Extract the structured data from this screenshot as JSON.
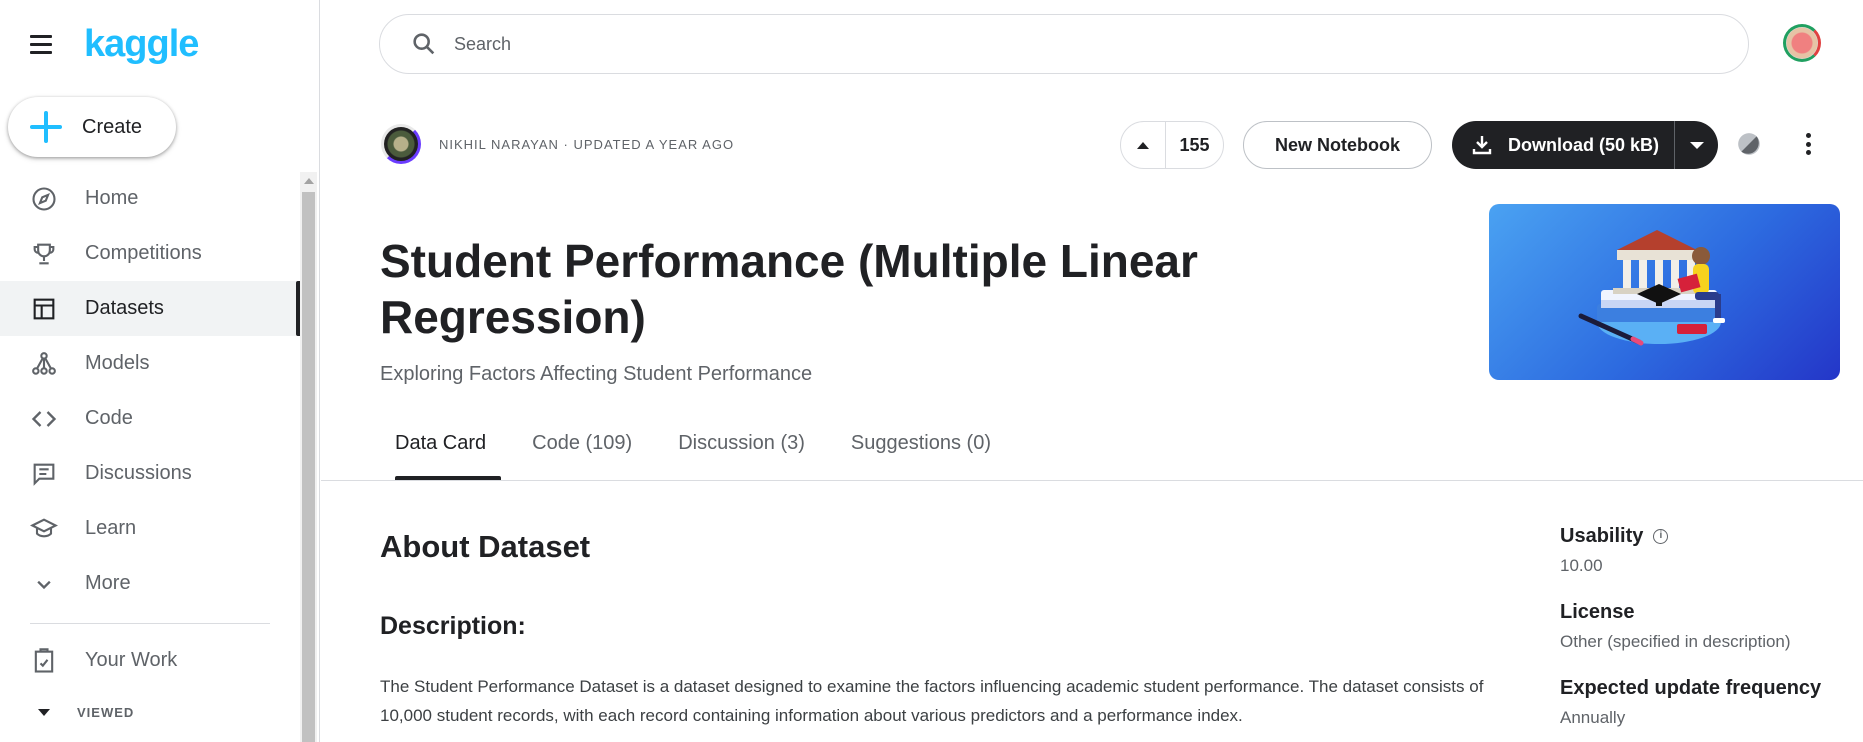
{
  "sidebar": {
    "logo": "kaggle",
    "create_label": "Create",
    "items": [
      {
        "label": "Home",
        "icon": "compass-icon",
        "active": false
      },
      {
        "label": "Competitions",
        "icon": "trophy-icon",
        "active": false
      },
      {
        "label": "Datasets",
        "icon": "table-icon",
        "active": true
      },
      {
        "label": "Models",
        "icon": "models-icon",
        "active": false
      },
      {
        "label": "Code",
        "icon": "code-icon",
        "active": false
      },
      {
        "label": "Discussions",
        "icon": "chat-icon",
        "active": false
      },
      {
        "label": "Learn",
        "icon": "graduation-cap-icon",
        "active": false
      },
      {
        "label": "More",
        "icon": "chevron-down-icon",
        "active": false
      }
    ],
    "your_work_label": "Your Work",
    "viewed_label": "VIEWED"
  },
  "search": {
    "placeholder": "Search"
  },
  "dataset": {
    "owner_meta": "NIKHIL NARAYAN · UPDATED A YEAR AGO",
    "votes": "155",
    "new_notebook_label": "New Notebook",
    "download_label": "Download (50 kB)",
    "title": "Student Performance (Multiple Linear Regression)",
    "subtitle": "Exploring Factors Affecting Student Performance"
  },
  "tabs": [
    {
      "label": "Data Card",
      "active": true
    },
    {
      "label": "Code (109)",
      "active": false
    },
    {
      "label": "Discussion (3)",
      "active": false
    },
    {
      "label": "Suggestions (0)",
      "active": false
    }
  ],
  "content": {
    "about_heading": "About Dataset",
    "description_heading": "Description:",
    "description_text": "The Student Performance Dataset is a dataset designed to examine the factors influencing academic student performance. The dataset consists of 10,000 student records, with each record containing information about various predictors and a performance index."
  },
  "meta": {
    "usability_label": "Usability",
    "usability_value": "10.00",
    "license_label": "License",
    "license_value": "Other (specified in description)",
    "frequency_label": "Expected update frequency",
    "frequency_value": "Annually"
  },
  "colors": {
    "brand": "#20beff",
    "dark": "#202124",
    "muted": "#5f6368"
  }
}
